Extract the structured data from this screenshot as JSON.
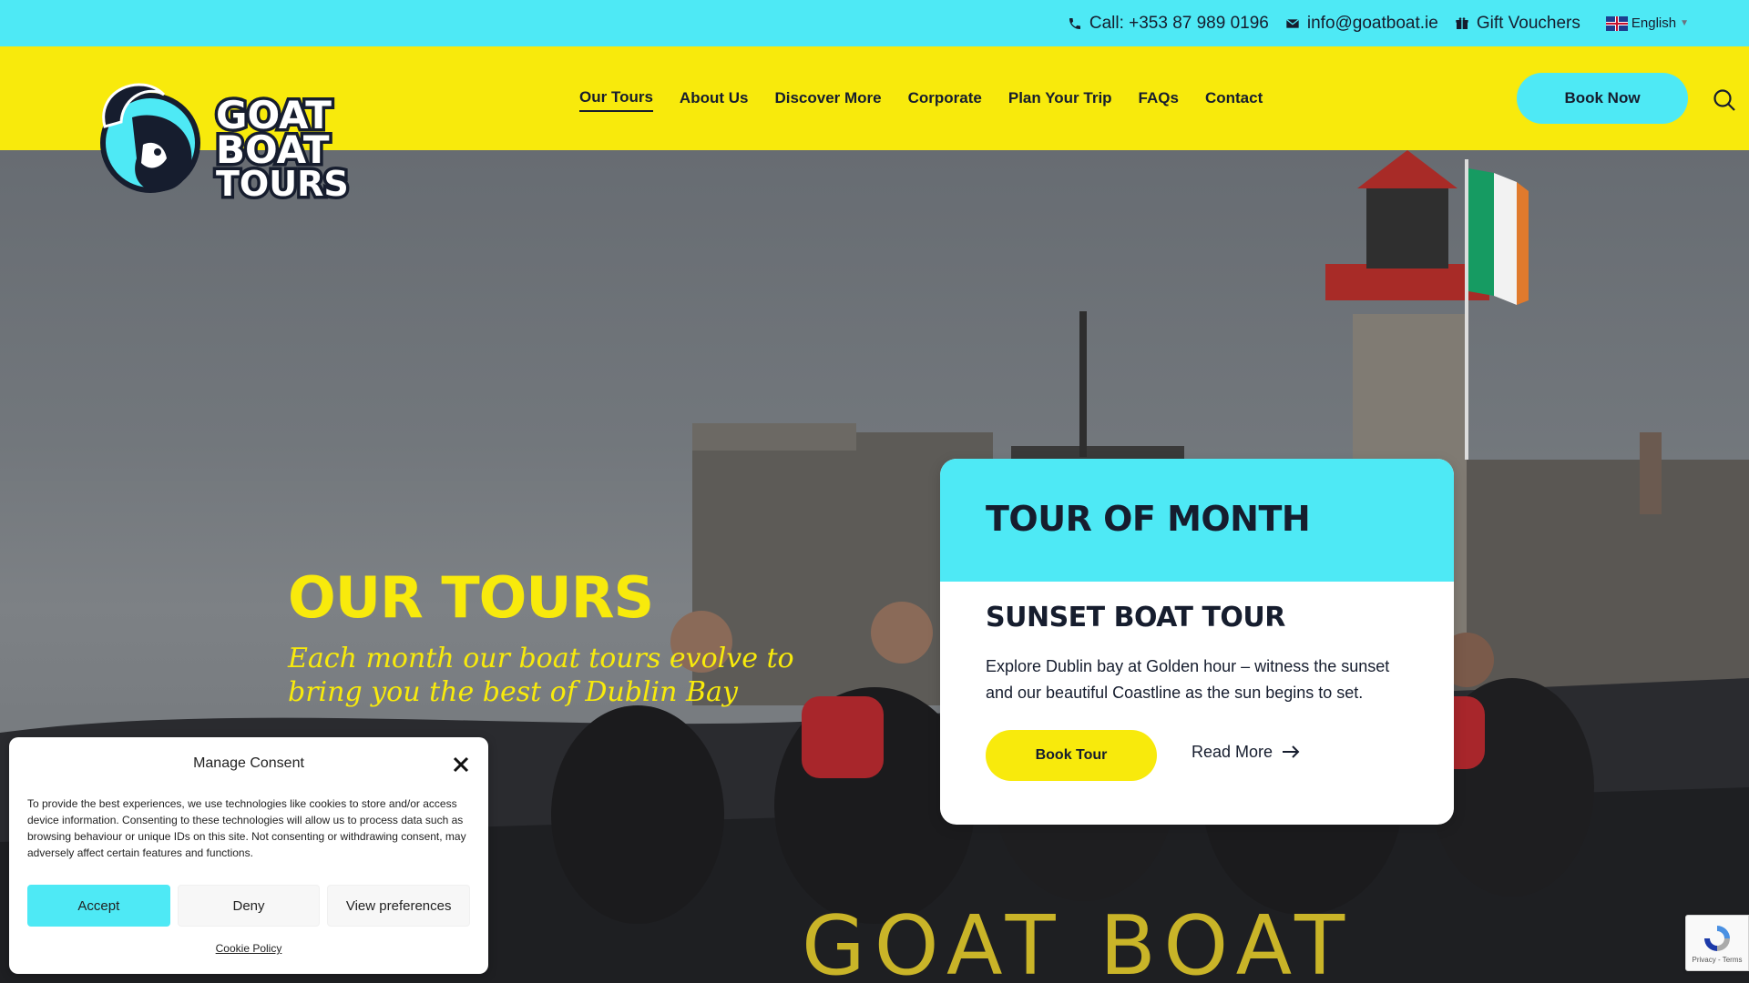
{
  "topbar": {
    "phone": "Call: +353 87 989 0196",
    "email": "info@goatboat.ie",
    "vouchers": "Gift Vouchers",
    "language": "English"
  },
  "header": {
    "logo_text": [
      "GOAT",
      "BOAT",
      "TOURS"
    ],
    "nav": [
      "Our Tours",
      "About Us",
      "Discover More",
      "Corporate",
      "Plan Your Trip",
      "FAQs",
      "Contact"
    ],
    "active_nav": "Our Tours",
    "book_now": "Book Now"
  },
  "hero": {
    "title": "OUR TOURS",
    "subtitle": "Each month our boat tours evolve to bring you the best of Dublin Bay",
    "boat_text": "GOAT BOAT"
  },
  "tour_card": {
    "heading": "TOUR OF MONTH",
    "tour_name": "SUNSET BOAT TOUR",
    "description": "Explore Dublin bay at Golden hour – witness the sunset and our beautiful Coastline as the sun begins to set.",
    "book_label": "Book Tour",
    "read_more_label": "Read More"
  },
  "consent": {
    "title": "Manage Consent",
    "body": "To provide the best experiences, we use technologies like cookies to store and/or access device information. Consenting to these technologies will allow us to process data such as browsing behaviour or unique IDs on this site. Not consenting or withdrawing consent, may adversely affect certain features and functions.",
    "accept": "Accept",
    "deny": "Deny",
    "preferences": "View preferences",
    "policy": "Cookie Policy"
  },
  "recaptcha": {
    "text": "Privacy - Terms"
  },
  "colors": {
    "cyan": "#4ee9f5",
    "yellow": "#f8ea0c",
    "navy": "#161d2e"
  }
}
